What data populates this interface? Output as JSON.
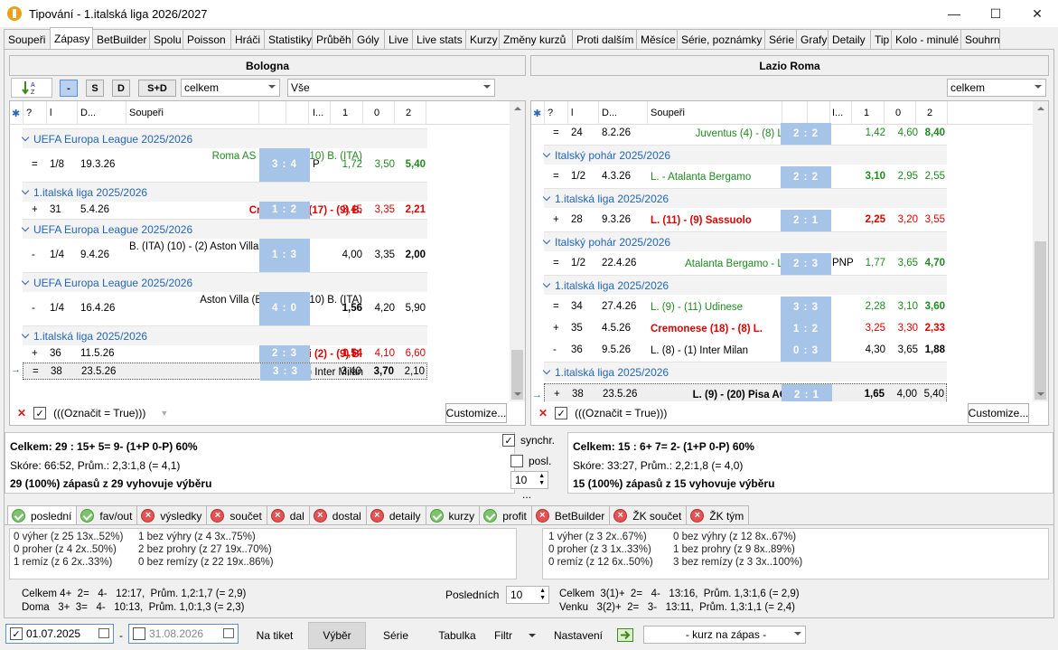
{
  "window": {
    "title": "Tipování - 1.italská liga 2026/2027",
    "minimize": "—",
    "maximize": "☐",
    "close": "✕"
  },
  "tabs": [
    "Soupeři",
    "Zápasy",
    "BetBuilder",
    "Spolu",
    "Poisson",
    "Hráči",
    "Statistiky",
    "Průběh",
    "Góly",
    "Live",
    "Live stats",
    "Kurzy",
    "Změny kurzů",
    "Proti dalším",
    "Měsíce",
    "Série, poznámky",
    "Série",
    "Grafy",
    "Detaily",
    "Tip",
    "Kolo - minulé",
    "Souhrn"
  ],
  "active_tab": "Zápasy",
  "left": {
    "team": "Bologna",
    "sort_btn": "A↓Z",
    "filter_buttons": [
      "-",
      "S",
      "D",
      "S+D"
    ],
    "combo1": "celkem",
    "combo2": "Vše",
    "columns": {
      "q": "?",
      "l": "l",
      "d": "D...",
      "opp": "Soupeři",
      "i": "I...",
      "c1": "1",
      "c0": "0",
      "c2": "2"
    },
    "groups": [
      {
        "label": "UEFA Europa League 2025/2026",
        "rows": [
          {
            "res": "=",
            "round": "1/8",
            "date": "19.3.26",
            "teams": "Roma AS (ITA) (8) - (10) B. (ITA)",
            "score": "3 : 4",
            "i": "P",
            "o1": "1,72",
            "o0": "3,50",
            "o2": "5,40",
            "color": "grn"
          }
        ]
      },
      {
        "label": "1.italská liga 2025/2026",
        "rows": [
          {
            "res": "+",
            "round": "31",
            "date": "5.4.26",
            "teams": "Cremonese (17) - (9) B.",
            "score": "1 : 2",
            "i": "",
            "o1": "3,45",
            "o0": "3,35",
            "o2": "2,21",
            "color": "red"
          }
        ]
      },
      {
        "label": "UEFA Europa League 2025/2026",
        "rows": [
          {
            "res": "-",
            "round": "1/4",
            "date": "9.4.26",
            "teams": "B. (ITA) (10) - (2) Aston Villa (ENG)",
            "score": "1 : 3",
            "i": "",
            "o1": "4,00",
            "o0": "3,35",
            "o2": "2,00",
            "color": ""
          }
        ]
      },
      {
        "label": "UEFA Europa League 2025/2026",
        "rows": [
          {
            "res": "-",
            "round": "1/4",
            "date": "16.4.26",
            "teams": "Aston Villa (ENG) (2) - (10) B. (ITA)",
            "score": "4 : 0",
            "i": "",
            "o1": "1,56",
            "o0": "4,20",
            "o2": "5,90",
            "color": ""
          }
        ]
      },
      {
        "label": "1.italská liga 2025/2026",
        "rows": [
          {
            "res": "+",
            "round": "36",
            "date": "11.5.26",
            "teams": "Napoli (2) - (9) B.",
            "score": "2 : 3",
            "i": "",
            "o1": "1,54",
            "o0": "4,10",
            "o2": "6,60",
            "color": "red"
          },
          {
            "res": "=",
            "round": "38",
            "date": "23.5.26",
            "teams": "B. (8) - (1) Inter Milan",
            "score": "3 : 3",
            "i": "",
            "o1": "3,40",
            "o0": "3,70",
            "o2": "2,10",
            "color": ""
          }
        ]
      }
    ],
    "filter_text": "(((Označit = True)))",
    "customize": "Customize...",
    "summary": [
      "Celkem: 29 : 15+  5=  9-  (1+P  0-P)  60%",
      "Skóre: 66:52, Prům.: 2,3:1,8 (= 4,1)",
      "29 (100%) zápasů z 29 vyhovuje výběru"
    ]
  },
  "right": {
    "team": "Lazio Roma",
    "combo1": "celkem",
    "groups": [
      {
        "label": "",
        "rows": [
          {
            "res": "=",
            "round": "24",
            "date": "8.2.26",
            "teams": "Juventus (4) - (8) L.",
            "score": "2 : 2",
            "i": "",
            "o1": "1,42",
            "o0": "4,60",
            "o2": "8,40",
            "color": "grn"
          }
        ]
      },
      {
        "label": "Italský pohár 2025/2026",
        "rows": [
          {
            "res": "=",
            "round": "1/2",
            "date": "4.3.26",
            "teams": "L. - Atalanta Bergamo",
            "score": "2 : 2",
            "i": "",
            "o1": "3,10",
            "o0": "2,95",
            "o2": "2,55",
            "color": "grn"
          }
        ]
      },
      {
        "label": "1.italská liga 2025/2026",
        "rows": [
          {
            "res": "+",
            "round": "28",
            "date": "9.3.26",
            "teams": "L. (11) - (9) Sassuolo",
            "score": "2 : 1",
            "i": "",
            "o1": "2,25",
            "o0": "3,20",
            "o2": "3,55",
            "color": "red"
          }
        ]
      },
      {
        "label": "Italský pohár 2025/2026",
        "rows": [
          {
            "res": "=",
            "round": "1/2",
            "date": "22.4.26",
            "teams": "Atalanta Bergamo - L.",
            "score": "2 : 3",
            "i": "PNP",
            "o1": "1,77",
            "o0": "3,65",
            "o2": "4,70",
            "color": "grn"
          }
        ]
      },
      {
        "label": "1.italská liga 2025/2026",
        "rows": [
          {
            "res": "=",
            "round": "34",
            "date": "27.4.26",
            "teams": "L. (9) - (11) Udinese",
            "score": "3 : 3",
            "i": "",
            "o1": "2,28",
            "o0": "3,10",
            "o2": "3,60",
            "color": "grn"
          },
          {
            "res": "+",
            "round": "35",
            "date": "4.5.26",
            "teams": "Cremonese (18) - (8) L.",
            "score": "1 : 2",
            "i": "",
            "o1": "3,25",
            "o0": "3,30",
            "o2": "2,33",
            "color": "red"
          },
          {
            "res": "-",
            "round": "36",
            "date": "9.5.26",
            "teams": "L. (8) - (1) Inter Milan",
            "score": "0 : 3",
            "i": "",
            "o1": "4,30",
            "o0": "3,65",
            "o2": "1,88",
            "color": ""
          }
        ]
      },
      {
        "label": "1.italská liga 2025/2026",
        "rows": [
          {
            "res": "+",
            "round": "38",
            "date": "23.5.26",
            "teams": "L. (9) - (20) Pisa AC",
            "score": "2 : 1",
            "i": "",
            "o1": "1,65",
            "o0": "4,00",
            "o2": "5,40",
            "color": ""
          }
        ]
      }
    ],
    "filter_text": "(((Označit = True)))",
    "customize": "Customize...",
    "summary": [
      "Celkem: 15 : 6+  7=  2-  (1+P  0-P)  60%",
      "Skóre: 33:27, Prům.: 2,2:1,8 (= 4,0)",
      "15 (100%) zápasů z 15 vyhovuje výběru"
    ]
  },
  "middle": {
    "synchr": "synchr.",
    "posl": "posl.",
    "posl_value": "10",
    "dots": "..."
  },
  "bottom_tabs": [
    {
      "label": "poslední",
      "state": "ok"
    },
    {
      "label": "fav/out",
      "state": "ok"
    },
    {
      "label": "výsledky",
      "state": "x"
    },
    {
      "label": "součet",
      "state": "x"
    },
    {
      "label": "dal",
      "state": "x"
    },
    {
      "label": "dostal",
      "state": "x"
    },
    {
      "label": "detaily",
      "state": "x"
    },
    {
      "label": "kurzy",
      "state": "ok"
    },
    {
      "label": "profit",
      "state": "ok"
    },
    {
      "label": "BetBuilder",
      "state": "x"
    },
    {
      "label": "ŽK součet",
      "state": "x"
    },
    {
      "label": "ŽK tým",
      "state": "x"
    }
  ],
  "stats_left": {
    "col1": [
      "0 výher (z 25 13x..52%)",
      "0 proher (z 4 2x..50%)",
      "1 remíz (z 6 2x..33%)"
    ],
    "col2": [
      "1 bez výhry (z 4 3x..75%)",
      "2 bez prohry (z 27 19x..70%)",
      "0 bez remízy (z 22 19x..86%)"
    ]
  },
  "stats_right": {
    "col1": [
      "1 výher (z 3 2x..67%)",
      "0 proher (z 3 1x..33%)",
      "0 remíz (z 12 6x..50%)"
    ],
    "col2": [
      "0 bez výhry (z 12 8x..67%)",
      "1 bez prohry (z 9 8x..89%)",
      "3 bez remízy (z 3 3x..100%)"
    ]
  },
  "form_left": [
    "Celkem 4+  2=   4-   12:17,  Prům. 1,2:1,7 (= 2,9)",
    "Doma   3+  3=   4-   10:13,  Prům. 1,0:1,3 (= 2,3)"
  ],
  "form_label": "Posledních",
  "form_count": "10",
  "form_right": [
    "Celkem  3(1)+  2=   4-   13:16,  Prům. 1,3:1,6 (= 2,9)",
    "Venku   3(2)+  2=   3-   13:11,  Prům. 1,3:1,1 (= 2,4)"
  ],
  "bottombar": {
    "date_from": "01.07.2025",
    "sep": "-",
    "date_to": "31.08.2026",
    "buttons": [
      "Na tiket",
      "Výběr",
      "Série",
      "Tabulka",
      "Filtr",
      "Nastavení"
    ],
    "odds_combo": "- kurz na zápas -"
  },
  "colors": {
    "accent": "#2566b8",
    "score_bg": "#a6c4e8",
    "red": "#e00000",
    "green": "#1f8a1f"
  }
}
